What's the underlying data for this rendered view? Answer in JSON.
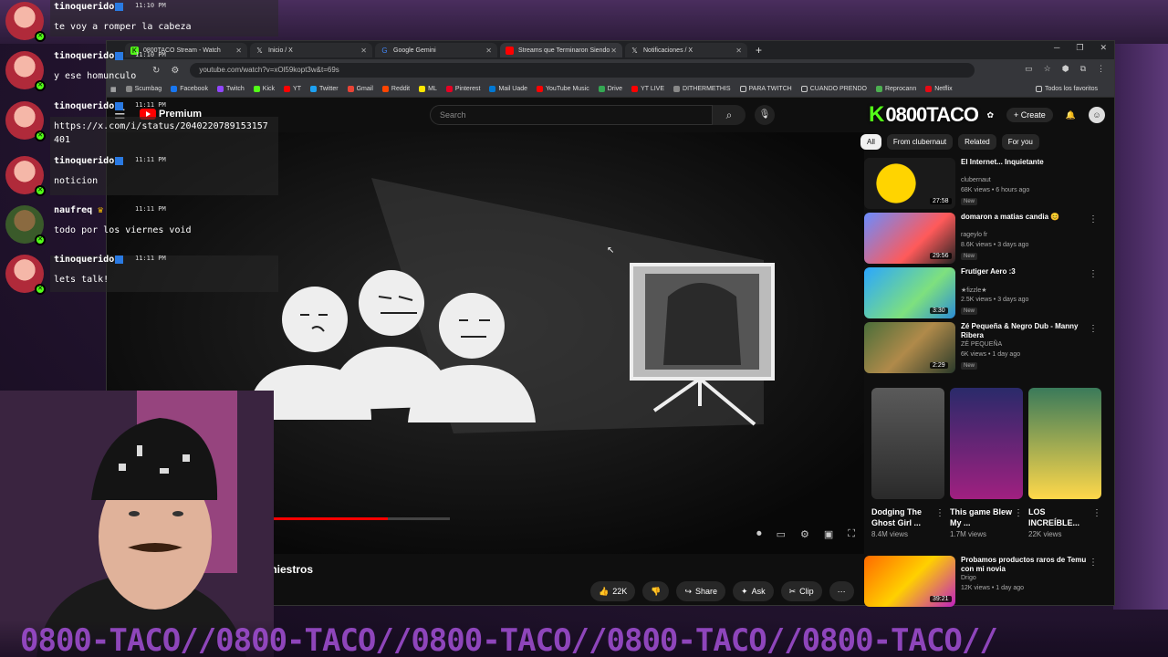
{
  "browser": {
    "tabs": [
      {
        "label": "0800TACO Stream - Watch",
        "icon": "kick-icon",
        "active": false
      },
      {
        "label": "Inicio / X",
        "icon": "x-icon",
        "active": false
      },
      {
        "label": "Google Gemini",
        "icon": "google-icon",
        "active": false
      },
      {
        "label": "Streams que Terminaron Siendo",
        "icon": "youtube-icon",
        "active": true
      },
      {
        "label": "Notificaciones / X",
        "icon": "x-icon",
        "active": false
      }
    ],
    "url": "youtube.com/watch?v=xOl59kopt3w&t=69s",
    "bookmarks": [
      "Scumbag",
      "Facebook",
      "Twitch",
      "Kick",
      "YT",
      "Twitter",
      "Gmail",
      "Reddit",
      "ML",
      "Pinterest",
      "Mail Uade",
      "YouTube Music",
      "Drive",
      "YT LIVE",
      "DITHERMETHIS",
      "PARA TWITCH",
      "CUANDO PRENDO",
      "Reprocann",
      "Netflix"
    ],
    "all_bookmarks": "Todos los favoritos"
  },
  "youtube": {
    "logo": "Premium",
    "search_placeholder": "Search",
    "create_label": "Create",
    "video_title": "do Siniestros",
    "progress": 0.7,
    "likes": "22K",
    "share_label": "Share",
    "ask_label": "Ask",
    "clip_label": "Clip",
    "chips": [
      "All",
      "From clubernaut",
      "Related",
      "For you"
    ],
    "recommendations": [
      {
        "title": "El Internet... Inquietante",
        "channel": "clubernaut",
        "meta": "68K views • 6 hours ago",
        "badge": "New",
        "duration": "27:58"
      },
      {
        "title": "domaron a matias candia 😊",
        "channel": "rageylo fr",
        "meta": "8.6K views • 3 days ago",
        "badge": "New",
        "duration": "29:56"
      },
      {
        "title": "Frutiger Aero :3",
        "channel": "★fizzle★",
        "meta": "2.5K views • 3 days ago",
        "badge": "New",
        "duration": "3:30"
      },
      {
        "title": "Zé Pequeña & Negro Dub - Manny Ribera",
        "channel": "ZÉ PEQUEÑA",
        "meta": "6K views • 1 day ago",
        "badge": "New",
        "duration": "2:29"
      }
    ],
    "shorts": [
      {
        "title": "Dodging The Ghost Girl ...",
        "views": "8.4M views"
      },
      {
        "title": "This game Blew My ...",
        "views": "1.7M views"
      },
      {
        "title": "LOS INCREÍBLE...",
        "views": "22K views"
      }
    ],
    "last_rec": {
      "title": "Probamos productos raros de Temu con mi novia",
      "channel": "Drigo",
      "meta": "12K views • 1 day ago",
      "duration": "39:21"
    }
  },
  "stream": {
    "brand": "0800TACO",
    "ticker": "0800-TACO//0800-TACO//0800-TACO//0800-TACO//0800-TACO//",
    "chat": [
      {
        "user": "tinoquerido",
        "time": "11:10 PM",
        "text": "te voy a romper la cabeza"
      },
      {
        "user": "tinoquerido",
        "time": "11:10 PM",
        "text": "y ese homunculo"
      },
      {
        "user": "tinoquerido",
        "time": "11:11 PM",
        "text": "https://x.com/i/status/2040220789153157\n401"
      },
      {
        "user": "tinoquerido",
        "time": "11:11 PM",
        "text": "noticion"
      },
      {
        "user": "naufreq",
        "time": "11:11 PM",
        "text": "todo por los viernes void"
      },
      {
        "user": "tinoquerido",
        "time": "11:11 PM",
        "text": "lets talk!"
      }
    ]
  }
}
